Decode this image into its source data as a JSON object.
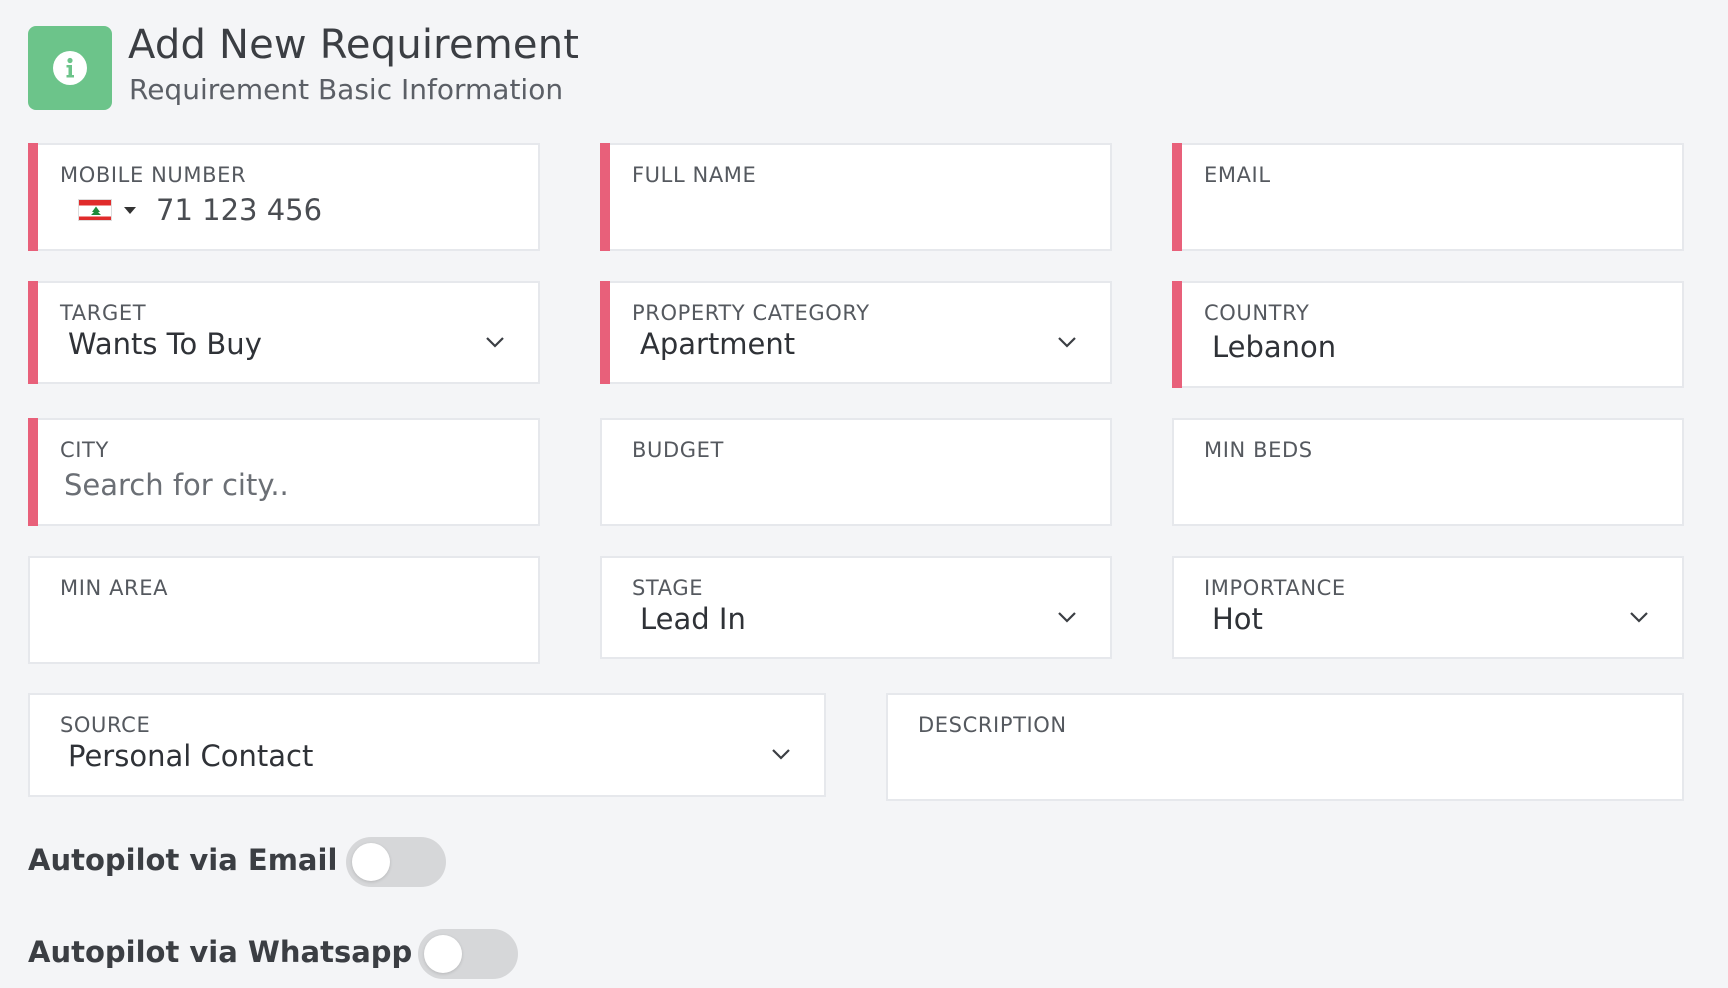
{
  "header": {
    "title": "Add New Requirement",
    "subtitle": "Requirement Basic Information",
    "icon": "info-icon",
    "accent": "#6cc48a"
  },
  "colors": {
    "required_marker": "#e8607a",
    "toggle_off": "#d6d7d9"
  },
  "fields": {
    "mobile": {
      "label": "MOBILE NUMBER",
      "country_flag": "lebanon-flag-icon",
      "placeholder": "71 123 456"
    },
    "full_name": {
      "label": "FULL NAME",
      "value": ""
    },
    "email": {
      "label": "EMAIL",
      "value": ""
    },
    "target": {
      "label": "TARGET",
      "value": "Wants To Buy"
    },
    "property_category": {
      "label": "PROPERTY CATEGORY",
      "value": "Apartment"
    },
    "country": {
      "label": "COUNTRY",
      "value": "Lebanon"
    },
    "city": {
      "label": "CITY",
      "placeholder": "Search for city.."
    },
    "budget": {
      "label": "BUDGET",
      "value": ""
    },
    "min_beds": {
      "label": "MIN BEDS",
      "value": ""
    },
    "min_area": {
      "label": "MIN AREA",
      "value": ""
    },
    "stage": {
      "label": "STAGE",
      "value": "Lead In"
    },
    "importance": {
      "label": "IMPORTANCE",
      "value": "Hot"
    },
    "source": {
      "label": "SOURCE",
      "value": "Personal Contact"
    },
    "description": {
      "label": "DESCRIPTION",
      "value": ""
    }
  },
  "toggles": {
    "email": {
      "label": "Autopilot via Email",
      "on": false
    },
    "whatsapp": {
      "label": "Autopilot via Whatsapp",
      "on": false
    }
  }
}
